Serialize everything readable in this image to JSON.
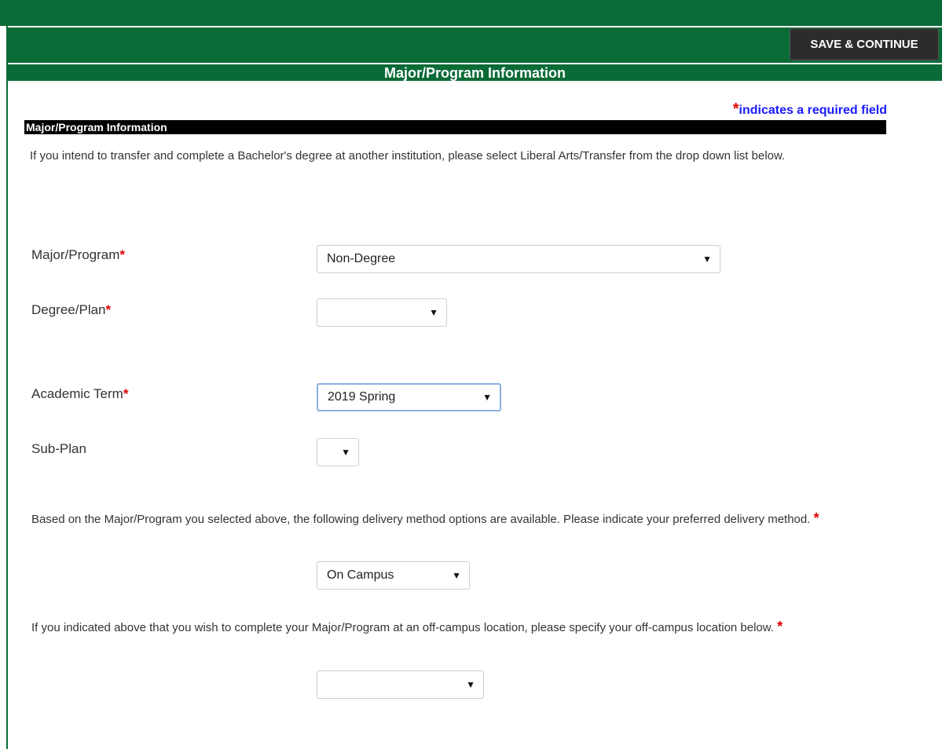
{
  "toolbar": {
    "save_label": "SAVE & CONTINUE"
  },
  "section_title": "Major/Program Information",
  "required_note": {
    "star": "*",
    "text": "indicates a required field"
  },
  "sub_header": "Major/Program Information",
  "intro_text": "If you intend to transfer and complete a Bachelor's degree at another institution, please select Liberal Arts/Transfer from the drop down list below.",
  "fields": {
    "major": {
      "label": "Major/Program",
      "star": "*",
      "value": "Non-Degree"
    },
    "degree": {
      "label": "Degree/Plan",
      "star": "*",
      "value": ""
    },
    "term": {
      "label": "Academic Term",
      "star": "*",
      "value": "2019 Spring"
    },
    "subplan": {
      "label": "Sub-Plan",
      "value": ""
    },
    "delivery": {
      "value": "On Campus"
    },
    "location": {
      "value": ""
    }
  },
  "delivery_text": "Based on the Major/Program you selected above, the following delivery method options are available. Please indicate your preferred delivery method.",
  "location_text": "If you indicated above that you wish to complete your Major/Program at an off-campus location, please specify your off-campus location below.",
  "star": "*",
  "arrow": "▼",
  "colors": {
    "brand_green": "#0b6b37",
    "required_red": "#e00000",
    "note_blue": "#1a1aff"
  }
}
